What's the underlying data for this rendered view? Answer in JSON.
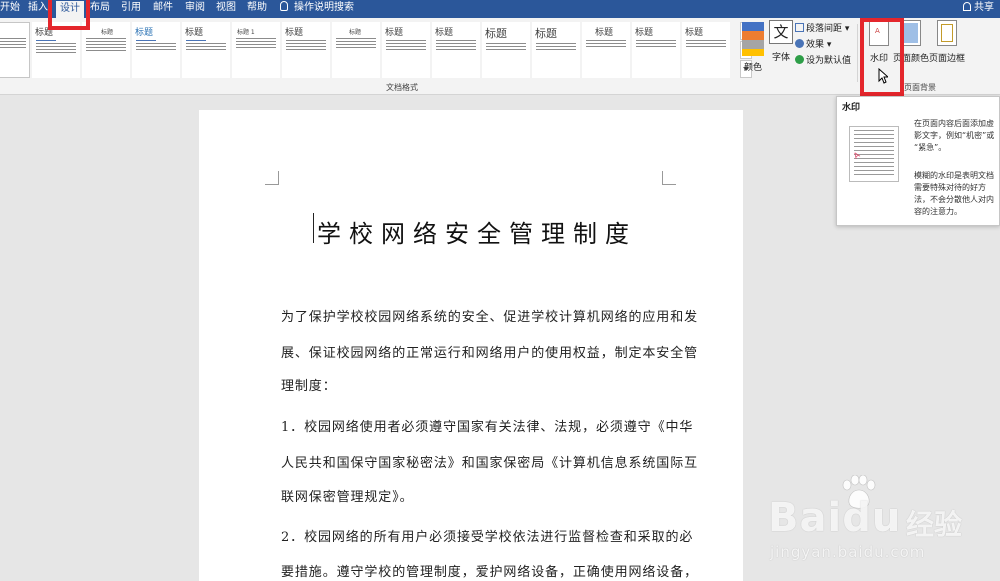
{
  "menubar": {
    "tabs": [
      "开始",
      "插入",
      "设计",
      "布局",
      "引用",
      "邮件",
      "审阅",
      "视图",
      "帮助"
    ],
    "tell_me": "操作说明搜索",
    "share": "共享"
  },
  "gallery": {
    "style_title": "标题",
    "heading1": "标题 1",
    "group_label": "文档格式"
  },
  "design": {
    "colors": "颜色",
    "fonts": "字体",
    "fonts_glyph": "文",
    "paragraph_spacing": "段落间距",
    "effects": "效果",
    "set_default": "设为默认值"
  },
  "page_background": {
    "watermark": "水印",
    "page_color": "页面颜色",
    "page_borders": "页面边框",
    "group_label": "页面背景"
  },
  "tooltip": {
    "title": "水印",
    "desc1_l1": "在页面内容后面添加虚",
    "desc1_l2": "影文字，例如“机密”或",
    "desc1_l3": "“紧急”。",
    "desc2_l1": "模糊的水印是表明文档",
    "desc2_l2": "需要特殊对待的好方",
    "desc2_l3": "法，不会分散他人对内",
    "desc2_l4": "容的注意力。"
  },
  "document": {
    "title": "学校网络安全管理制度",
    "p1_l1": "为了保护学校校园网络系统的安全、促进学校计算机网络的应用和发",
    "p1_l2": "展、保证校园网络的正常运行和网络用户的使用权益，制定本安全管",
    "p1_l3": "理制度：",
    "p2_l1": "1．校园网络使用者必须遵守国家有关法律、法规，必须遵守《中华",
    "p2_l2": "人民共和国保守国家秘密法》和国家保密局《计算机信息系统国际互",
    "p2_l3": "联网保密管理规定》。",
    "p3_l1": "2．校园网络的所有用户必须接受学校依法进行监督检查和采取的必",
    "p3_l2": "要措施。遵守学校的管理制度，爱护网络设备，正确使用网络设备，"
  },
  "watermark_brand": {
    "logo": "Baidu",
    "jingyan": "经验",
    "url": "jingyan.baidu.com"
  },
  "colors": {
    "menubar": "#2b579a",
    "highlight": "#e4262c",
    "theme_swatches": [
      "#4472c4",
      "#ed7d31",
      "#a5a5a5",
      "#ffc000"
    ]
  }
}
